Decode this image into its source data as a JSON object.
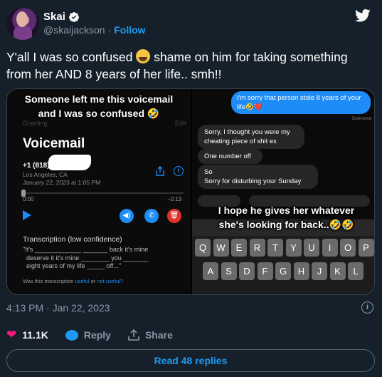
{
  "author": {
    "name": "Skai",
    "handle": "@skaijackson",
    "separator": "·",
    "follow_label": "Follow"
  },
  "tweet": {
    "text_before_emoji": "Y'all I was so confused",
    "text_after_emoji": "shame on him for taking something from her AND 8 years of her life.. smh!!"
  },
  "media": {
    "left": {
      "caption_line1": "Someone left me this voicemail",
      "caption_line2": "and I was so confused 🤣",
      "greeting": "Greeting",
      "edit": "Edit",
      "title": "Voicemail",
      "number": "+1 (818)",
      "location": "Los Angeles, CA",
      "date": "January 22, 2023 at 1:05 PM",
      "time_start": "0:00",
      "time_end": "−0:13",
      "transcription_title": "Transcription (low confidence)",
      "transcription_body": "\"It's _____________ _______ back it's mine\n  deserve it it's mine ________ you _______\n  eight years of my life _____ off...\"",
      "footer_prefix": "Was this transcription",
      "footer_useful": "useful",
      "footer_or": "or",
      "footer_not_useful": "not useful?"
    },
    "right": {
      "sent_message": "I'm sorry that person stole 8 years of your life🤣❤️",
      "delivered": "Delivered",
      "msg1": "Sorry, I thought you were my cheating piece of shit ex",
      "msg2": "One number off",
      "msg3a": "So",
      "msg3b": "Sorry for disturbing your Sunday",
      "caption_line1": "I hope he gives her whatever",
      "caption_line2": "she's looking for back..🤣🤣",
      "keys_row1": [
        "Q",
        "W",
        "E",
        "R",
        "T",
        "Y",
        "U",
        "I",
        "O",
        "P"
      ],
      "keys_row2": [
        "A",
        "S",
        "D",
        "F",
        "G",
        "H",
        "J",
        "K",
        "L"
      ]
    }
  },
  "meta": {
    "timestamp": "4:13 PM · Jan 22, 2023",
    "info_icon": "i"
  },
  "actions": {
    "likes": "11.1K",
    "reply_label": "Reply",
    "share_label": "Share"
  },
  "read_replies": "Read 48 replies"
}
